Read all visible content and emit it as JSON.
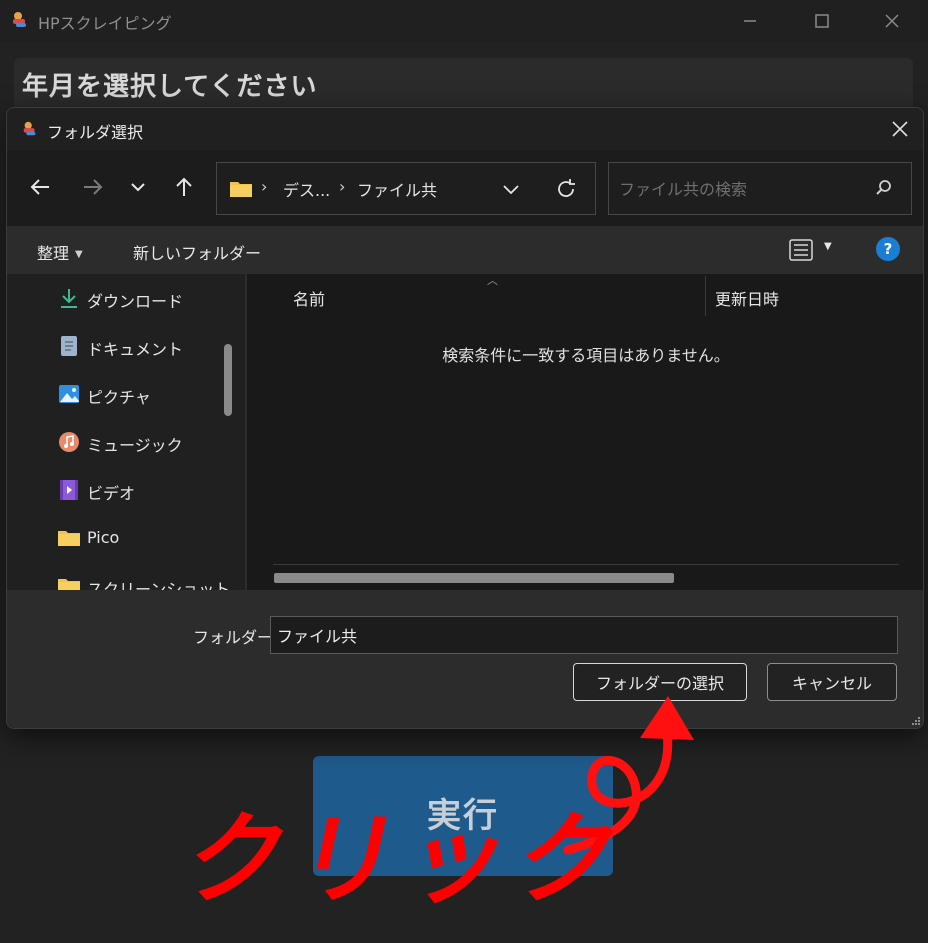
{
  "app": {
    "title": "HPスクレイピング",
    "header": "年月を選択してください",
    "run_label": "実行"
  },
  "dialog": {
    "title": "フォルダ選択",
    "breadcrumb": [
      "デス...",
      "ファイル共"
    ],
    "search_placeholder": "ファイル共の検索",
    "commands": {
      "organize": "整理",
      "new_folder": "新しいフォルダー",
      "help": "?"
    },
    "nav_items": [
      {
        "label": "ダウンロード",
        "icon": "download-icon",
        "pinned": true
      },
      {
        "label": "ドキュメント",
        "icon": "document-icon",
        "pinned": true
      },
      {
        "label": "ピクチャ",
        "icon": "pictures-icon",
        "pinned": true
      },
      {
        "label": "ミュージック",
        "icon": "music-icon",
        "pinned": true
      },
      {
        "label": "ビデオ",
        "icon": "video-icon",
        "pinned": true
      },
      {
        "label": "Pico",
        "icon": "folder-icon",
        "pinned": true
      },
      {
        "label": "スクリーンショット",
        "icon": "folder-icon",
        "pinned": false
      }
    ],
    "columns": {
      "name": "名前",
      "date": "更新日時"
    },
    "empty_message": "検索条件に一致する項目はありません。",
    "folder_label": "フォルダー:",
    "folder_value": "ファイル共",
    "select_button": "フォルダーの選択",
    "cancel_button": "キャンセル"
  },
  "annotation": {
    "text": "クリック",
    "color": "#ff0000"
  },
  "colors": {
    "accent": "#1f5a8c",
    "help": "#1a7fd4",
    "folder": "#f2c14e"
  }
}
